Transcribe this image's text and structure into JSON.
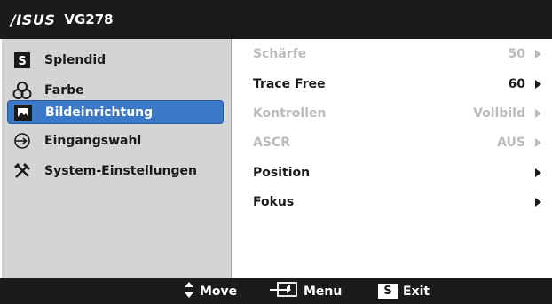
{
  "header": {
    "brand": "/ISUS",
    "model": "VG278"
  },
  "sidebar": {
    "items": [
      {
        "label": "Splendid",
        "icon": "splendid-s-icon",
        "selected": false
      },
      {
        "label": "Farbe",
        "icon": "color-circles-icon",
        "selected": false
      },
      {
        "label": "Bildeinrichtung",
        "icon": "image-setup-icon",
        "selected": true
      },
      {
        "label": "Eingangswahl",
        "icon": "input-select-icon",
        "selected": false
      },
      {
        "label": "System-Einstellungen",
        "icon": "tools-icon",
        "selected": false
      }
    ]
  },
  "settings": {
    "rows": [
      {
        "label": "Schärfe",
        "value": "50",
        "enabled": false
      },
      {
        "label": "Trace Free",
        "value": "60",
        "enabled": true
      },
      {
        "label": "Kontrollen",
        "value": "Vollbild",
        "enabled": false
      },
      {
        "label": "ASCR",
        "value": "AUS",
        "enabled": false
      },
      {
        "label": "Position",
        "value": "",
        "enabled": true
      },
      {
        "label": "Fokus",
        "value": "",
        "enabled": true
      }
    ]
  },
  "footer": {
    "move_label": "Move",
    "menu_label": "Menu",
    "exit_label": "Exit",
    "exit_key": "S"
  },
  "colors": {
    "bar_bg": "#1b1b1b",
    "sidebar_bg": "#d2d4d6",
    "selection": "#3b79c8",
    "disabled_text": "#b9bcbf"
  }
}
